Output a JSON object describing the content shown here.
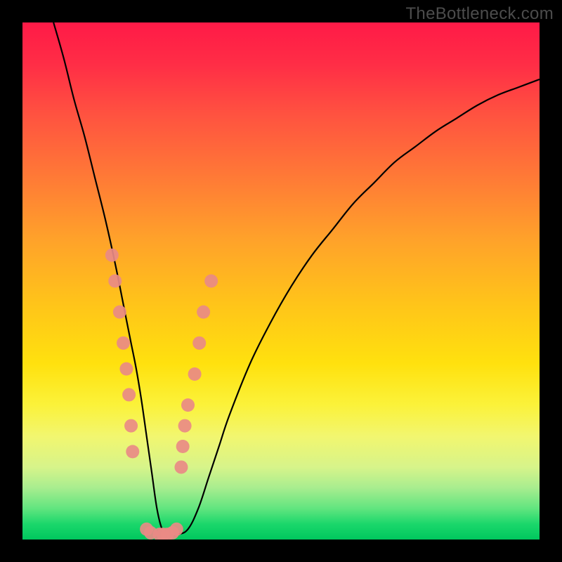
{
  "watermark": "TheBottleneck.com",
  "chart_data": {
    "type": "line",
    "title": "",
    "xlabel": "",
    "ylabel": "",
    "xlim": [
      0,
      100
    ],
    "ylim": [
      0,
      100
    ],
    "curve": {
      "name": "bottleneck-curve",
      "x": [
        6,
        8,
        10,
        12,
        14,
        16,
        18,
        20,
        21,
        22,
        23,
        24,
        25,
        26,
        27,
        28,
        30,
        32,
        34,
        36,
        38,
        40,
        44,
        48,
        52,
        56,
        60,
        64,
        68,
        72,
        76,
        80,
        84,
        88,
        92,
        96,
        100
      ],
      "y": [
        100,
        93,
        85,
        78,
        70,
        62,
        53,
        43,
        38,
        33,
        27,
        20,
        13,
        6,
        2,
        1,
        1,
        2,
        6,
        12,
        18,
        24,
        34,
        42,
        49,
        55,
        60,
        65,
        69,
        73,
        76,
        79,
        81.5,
        84,
        86,
        87.5,
        89
      ]
    },
    "markers_left": {
      "x": [
        17.3,
        17.9,
        18.8,
        19.5,
        20.1,
        20.6,
        21.0,
        21.3
      ],
      "y": [
        55,
        50,
        44,
        38,
        33,
        28,
        22,
        17
      ]
    },
    "markers_right": {
      "x": [
        30.7,
        31.0,
        31.4,
        32.0,
        33.3,
        34.2,
        35.0,
        36.5
      ],
      "y": [
        14,
        18,
        22,
        26,
        32,
        38,
        44,
        50
      ]
    },
    "markers_bottom": {
      "x": [
        24.0,
        24.8,
        26.5,
        27.2,
        28.0,
        29.0,
        29.8
      ],
      "y": [
        2.0,
        1.3,
        1.0,
        1.0,
        1.0,
        1.3,
        2.0
      ]
    },
    "marker_color": "#e98a86",
    "curve_color": "#000000"
  }
}
